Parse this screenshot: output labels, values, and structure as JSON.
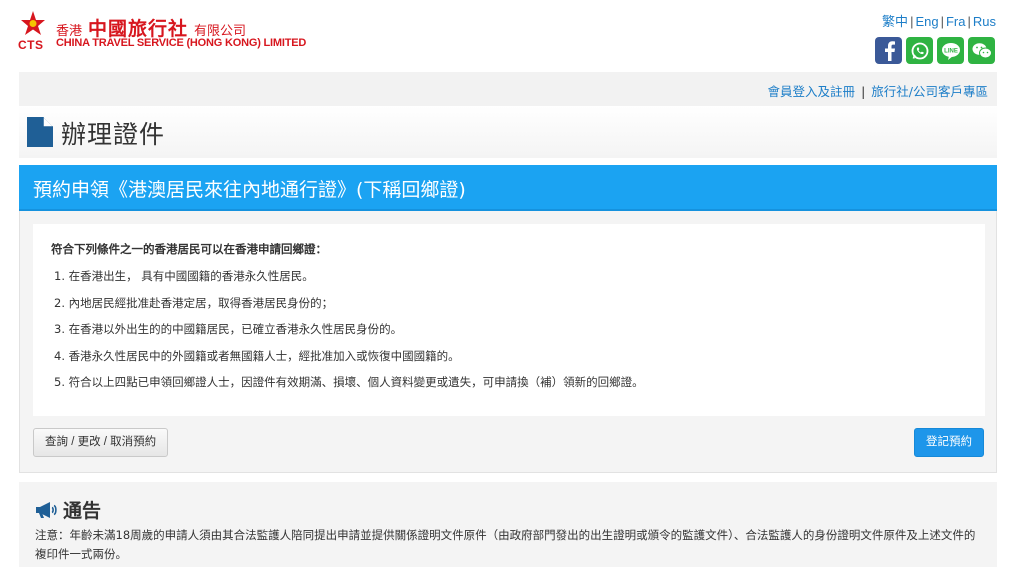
{
  "header": {
    "logo_cn_small_left": "香港",
    "logo_cn_big": "中國旅行社",
    "logo_cn_small_right": "有限公司",
    "logo_en": "CHINA TRAVEL SERVICE (HONG KONG) LIMITED",
    "logo_cts": "CTS",
    "languages": [
      "繁中",
      "Eng",
      "Fra",
      "Rus"
    ],
    "social": [
      "facebook-icon",
      "whatsapp-icon",
      "line-icon",
      "wechat-icon"
    ]
  },
  "subnav": {
    "member_login": "會員登入及註冊",
    "separator": "|",
    "agency_area": "旅行社/公司客戶專區"
  },
  "page": {
    "title": "辦理證件"
  },
  "panel": {
    "heading": "預約申領《港澳居民來往內地通行證》(下稱回鄉證)",
    "conditions_title": "符合下列條件之一的香港居民可以在香港申請回鄉證：",
    "conditions": [
      "1. 在香港出生， 具有中國國籍的香港永久性居民。",
      "2. 內地居民經批准赴香港定居，取得香港居民身份的；",
      "3. 在香港以外出生的的中國籍居民，已確立香港永久性居民身份的。",
      "4. 香港永久性居民中的外國籍或者無國籍人士，經批准加入或恢復中國國籍的。",
      "5. 符合以上四點已申領回鄉證人士，因證件有效期滿、損壞、個人資料變更或遺失，可申請換（補）領新的回鄉證。"
    ],
    "query_button": "查詢 / 更改 / 取消預約",
    "book_button": "登記預約"
  },
  "notice": {
    "title": "通告",
    "text": "注意：年齡未滿18周歲的申請人須由其合法監護人陪同提出申請並提供關係證明文件原件（由政府部門發出的出生證明或頒令的監護文件）、合法監護人的身份證明文件原件及上述文件的複印件一式兩份。"
  },
  "colors": {
    "brand_red": "#d7161e",
    "panel_blue": "#1ba3f2",
    "button_blue": "#1e96ea",
    "link_blue": "#1d7ec8"
  }
}
